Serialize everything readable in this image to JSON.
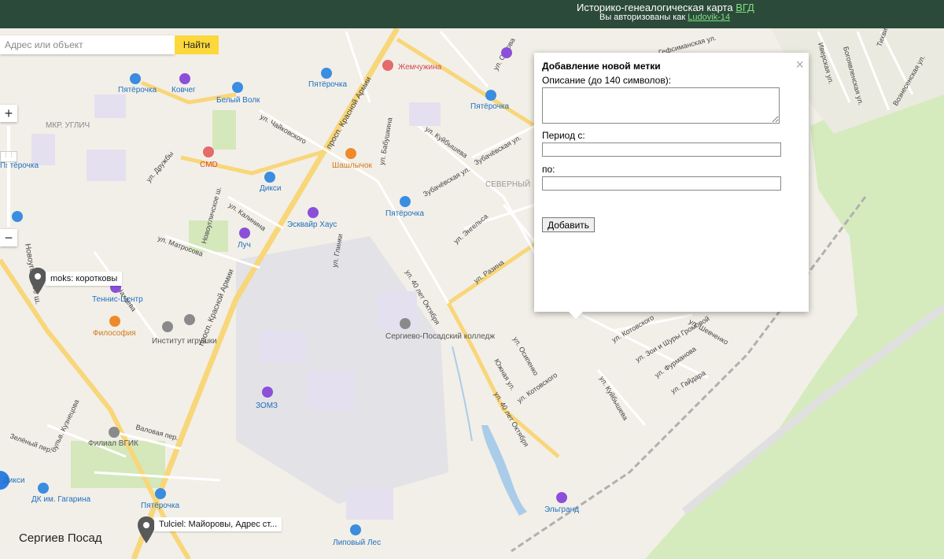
{
  "header": {
    "title_prefix": "Историко-генеалогическая карта ",
    "title_link": "ВГД",
    "auth_prefix": "Вы авторизованы как ",
    "auth_user": "Ludovik-14"
  },
  "search": {
    "placeholder": "Адрес или объект",
    "button_label": "Найти"
  },
  "zoom": {
    "in_label": "+",
    "out_label": "−"
  },
  "popup": {
    "title": "Добавление новой метки",
    "description_label": "Описание (до 140 символов):",
    "period_from_label": "Период с:",
    "period_to_label": "по:",
    "add_button": "Добавить",
    "close_glyph": "×"
  },
  "markers": [
    {
      "label": "moks: коротковы"
    },
    {
      "label": "Tulciel: Майоровы, Адрес ст..."
    }
  ],
  "city_label": "Сергиев Посад",
  "map_labels": {
    "districts": [
      "МКР. УГЛИЧ",
      "СЕВЕРНЫЙ"
    ],
    "streets": [
      "просп. Красной Армии",
      "просп. Красной Армии",
      "ул. Дружбы",
      "ул. Чайковского",
      "ул. Калинина",
      "Новоугличское ш.",
      "ул. Матросова",
      "ул. Мичурина",
      "Новоугольное ш.",
      "ул. Глинки",
      "ул. Бабушкина",
      "ул. Бабушкина",
      "ул. Куйбышева",
      "ул. Куйбышева",
      "Зубачёвская ул.",
      "Зубачёвская ул.",
      "ул. Энгельса",
      "ул. Разина",
      "ул. 40 лет Октября",
      "ул. 40 лет Октября",
      "Южная ул.",
      "ул. Осипенко",
      "ул. Котовского",
      "ул. Котовского",
      "ул. Куйбышева",
      "ул. Шевченко",
      "ул. Фурманова",
      "ул. Гайдара",
      "ул. Серова",
      "Гефсиманская ул.",
      "Иверская ул.",
      "Богоявленская ул.",
      "Вознесенская ул.",
      "Тихвинская ул.",
      "Валовая пер.",
      "бульв. Кузнецова",
      "Зелёный пер.",
      "ул. Нахаева",
      "ул. Зои и Шуры Громовой"
    ],
    "pois": [
      "Пятёрочка",
      "Ковчег",
      "Белый Волк",
      "Пятёрочка",
      "Жемчужина",
      "Пятёрочка",
      "CMD",
      "Дикси",
      "Шашлычок",
      "Пятёрочка",
      "Эсквайр Хаус",
      "Луч",
      "Теннис-Центр",
      "Философия",
      "Институт игрушки",
      "Сергиево-Посадский колледж",
      "ЗОМЗ",
      "Филиал ВГИК",
      "Пятёрочка",
      "ДК им. Гагарина",
      "Липовый Лес",
      "Эльгранд",
      "Дикси",
      "Пятёрочка"
    ]
  },
  "colors": {
    "header_bg": "#2c4a3a",
    "link": "#7fe37f",
    "search_button": "#fcd83a",
    "major_road": "#f8d67a",
    "forest": "#cfe8b0",
    "water": "#a9cce9",
    "railway": "#b8b8b8",
    "poi_blue": "#3a8de0",
    "poi_orange": "#ef8a2a",
    "poi_purple": "#8c4fd9",
    "poi_gray": "#8a8a8a",
    "poi_red": "#e56a6a"
  }
}
